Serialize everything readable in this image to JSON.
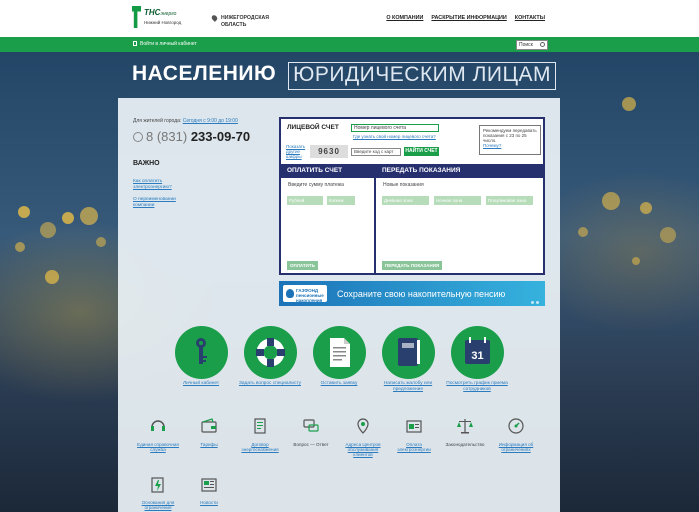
{
  "logo": {
    "brand": "ТНС",
    "brand_suffix": "энерго",
    "city": "Нижний Новгород"
  },
  "region": {
    "label": "НИЖЕГОРОДСКАЯ ОБЛАСТЬ"
  },
  "topnav": [
    "О КОМПАНИИ",
    "РАСКРЫТИЕ ИНФОРМАЦИИ",
    "КОНТАКТЫ"
  ],
  "greenbar": {
    "login_label": "Войти в личный кабинет",
    "search_placeholder": "Поиск"
  },
  "tabs": {
    "population": "НАСЕЛЕНИЮ",
    "legal": "ЮРИДИЧЕСКИМ ЛИЦАМ"
  },
  "contact": {
    "city_label": "Для жителей города:",
    "hours": "Сегодня с 9:00 до 19:00",
    "phone_prefix": "8 (831)",
    "phone_number": "233-09-70"
  },
  "important": {
    "title": "ВАЖНО",
    "links": [
      "Как оплатить электроэнергию?",
      "О переименовании компании"
    ]
  },
  "account": {
    "title": "ЛИЦЕВОЙ СЧЕТ",
    "number_placeholder": "Номер лицевого счета",
    "how_to_link": "Где узнать свой номер лицевого счета?",
    "captcha_link": "Показать другие шифры",
    "captcha_value": "9630",
    "code_placeholder": "Введите код с карт",
    "find_button": "НАЙТИ СЧЕТ",
    "note_text": "Рекомендуем передавать показания с 23 по 25 число.",
    "note_link": "Почему?"
  },
  "pay": {
    "title": "ОПЛАТИТЬ СЧЕТ",
    "label": "Введите сумму платежа",
    "fields": [
      "Рублей",
      "Копеек"
    ],
    "button": "ОПЛАТИТЬ"
  },
  "meters": {
    "title": "ПЕРЕДАТЬ ПОКАЗАНИЯ",
    "label": "Новые показания",
    "fields": [
      "Дневная зона",
      "Ночная зона",
      "Полупиковая зона"
    ],
    "button": "ПЕРЕДАТЬ ПОКАЗАНИЯ"
  },
  "banner": {
    "logo_text": "ГАЗФОНД пенсионные накопления",
    "text": "Сохраните свою накопительную пенсию"
  },
  "big_services": [
    {
      "label": "Личный кабинет",
      "icon": "key-icon"
    },
    {
      "label": "Задать вопрос специалисту",
      "icon": "lifebuoy-icon"
    },
    {
      "label": "Оставить заявку",
      "icon": "document-icon"
    },
    {
      "label": "Написать жалобу или предложение",
      "icon": "book-icon"
    },
    {
      "label": "Посмотреть график приема сотрудников",
      "icon": "calendar-icon",
      "calendar_day": "31"
    }
  ],
  "small_services": [
    {
      "label": "Единая справочная служба",
      "icon": "headset-icon"
    },
    {
      "label": "Тарифы",
      "icon": "wallet-icon"
    },
    {
      "label": "Договор энергоснабжения",
      "icon": "contract-icon"
    },
    {
      "label": "Вопрос — Ответ",
      "icon": "chat-icon",
      "plain": true
    },
    {
      "label": "Адреса Центров обслуживания клиентов",
      "icon": "map-pin-icon"
    },
    {
      "label": "Оплата электроэнергии",
      "icon": "payment-icon"
    },
    {
      "label": "Законодательство",
      "icon": "scales-icon",
      "plain": true
    },
    {
      "label": "Информация об ограничениях",
      "icon": "info-meter-icon"
    },
    {
      "label": "Основания для ограничения",
      "icon": "bolt-document-icon"
    },
    {
      "label": "Новости",
      "icon": "news-icon"
    }
  ],
  "colors": {
    "green": "#1a9e4a",
    "navy": "#27306f",
    "link": "#2a7bbf"
  }
}
